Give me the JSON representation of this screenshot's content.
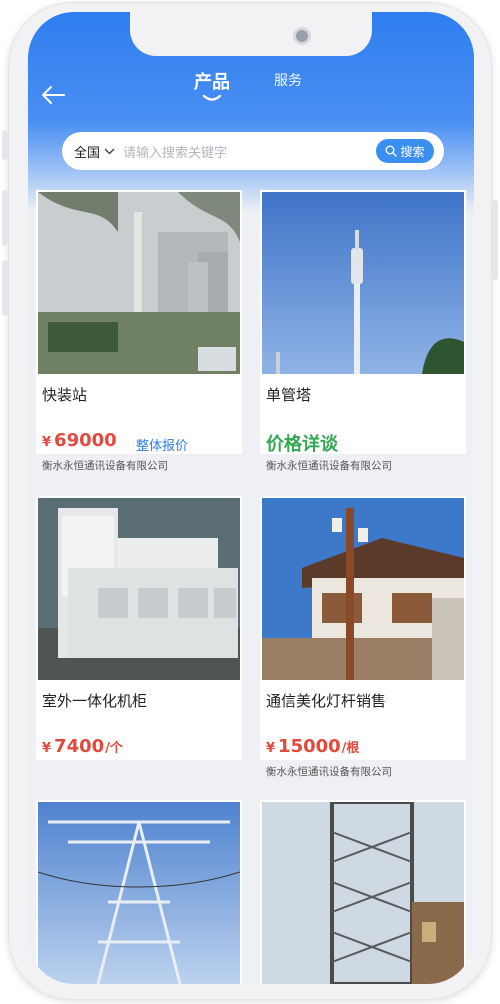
{
  "header": {
    "tabs": [
      {
        "label": "产品"
      },
      {
        "label": "服务"
      }
    ]
  },
  "search": {
    "region": "全国",
    "placeholder": "请输入搜索关键字",
    "button_label": "搜索"
  },
  "products": [
    {
      "title": "快装站",
      "currency": "¥",
      "price": "69000",
      "unit": "",
      "tag": "整体报价",
      "company": "衡水永恒通讯设备有限公司"
    },
    {
      "title": "单管塔",
      "price_text": "价格详谈",
      "company": "衡水永恒通讯设备有限公司"
    },
    {
      "title": "室外一体化机柜",
      "currency": "¥",
      "price": "7400",
      "unit": "/个",
      "company": ""
    },
    {
      "title": "通信美化灯杆销售",
      "currency": "¥",
      "price": "15000",
      "unit": "/根",
      "company": "衡水永恒通讯设备有限公司"
    }
  ],
  "colors": {
    "header_blue": "#2e7ef0",
    "price_red": "#e3493c",
    "negotiable_green": "#34a853",
    "tag_blue": "#2f7de0"
  }
}
